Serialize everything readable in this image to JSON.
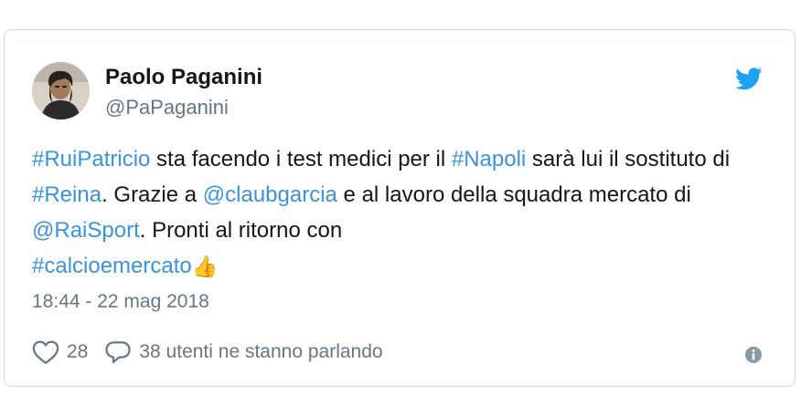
{
  "author": {
    "name": "Paolo Paganini",
    "handle": "@PaPaganini"
  },
  "tweet": {
    "segments": [
      {
        "text": "#RuiPatricio",
        "link": true
      },
      {
        "text": " sta facendo i test medici per il ",
        "link": false
      },
      {
        "text": "#Napoli",
        "link": true
      },
      {
        "text": " sarà lui il sostituto di ",
        "link": false
      },
      {
        "text": "#Reina",
        "link": true
      },
      {
        "text": ". Grazie a ",
        "link": false
      },
      {
        "text": "@claubgarcia",
        "link": true
      },
      {
        "text": " e al lavoro della squadra mercato di ",
        "link": false
      },
      {
        "text": "@RaiSport",
        "link": true
      },
      {
        "text": ". Pronti al ritorno con ",
        "link": false
      },
      {
        "text": "#calcioemercato",
        "link": true
      }
    ],
    "emoji": "👍",
    "timestamp": "18:44 - 22 mag 2018"
  },
  "actions": {
    "like_icon": "heart-icon",
    "like_count": "28",
    "reply_icon": "speech-bubble-icon",
    "conversation_text": "38 utenti ne stanno parlando",
    "info_icon": "info-icon"
  },
  "colors": {
    "link": "#3b94d9",
    "twitter_blue": "#1da1f2",
    "text": "#14171a",
    "muted": "#657786",
    "border": "#cfd9de"
  }
}
